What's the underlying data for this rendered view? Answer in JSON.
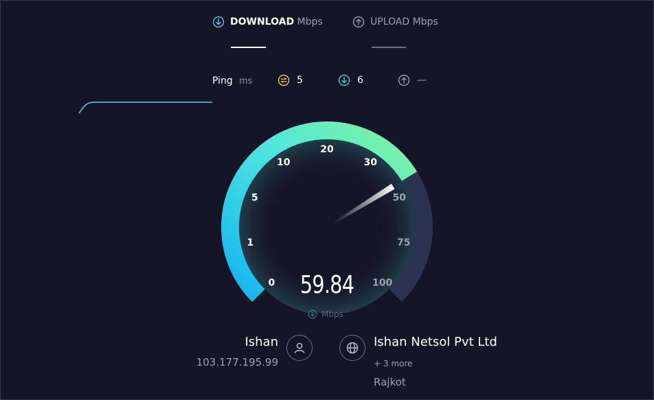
{
  "tabs": {
    "download": {
      "label": "DOWNLOAD",
      "unit": "Mbps"
    },
    "upload": {
      "label": "UPLOAD",
      "unit": "Mbps"
    }
  },
  "ping": {
    "label": "Ping",
    "unit": "ms",
    "idle": "5",
    "download": "6",
    "upload": "—"
  },
  "gauge": {
    "ticks": [
      "0",
      "1",
      "5",
      "10",
      "20",
      "30",
      "50",
      "75",
      "100"
    ],
    "needle_fraction": 0.716
  },
  "speed": {
    "value": "59.84",
    "unit": "Mbps"
  },
  "client": {
    "name": "Ishan",
    "ip": "103.177.195.99"
  },
  "server": {
    "name": "Ishan Netsol Pvt Ltd",
    "more": "+ 3 more",
    "location": "Rajkot"
  },
  "colors": {
    "background": "#141526",
    "gauge_start": "#12b3f0",
    "gauge_mid": "#4ee6e0",
    "gauge_end": "#7ef59a",
    "track": "#2b3350",
    "download_accent": "#5ad1e8",
    "ping_idle": "#f2d24b"
  },
  "icons": {
    "download": "arrow-down-circle-icon",
    "upload": "arrow-up-circle-icon",
    "idle_ping": "idle-latency-icon",
    "client": "person-icon",
    "server": "globe-icon"
  }
}
